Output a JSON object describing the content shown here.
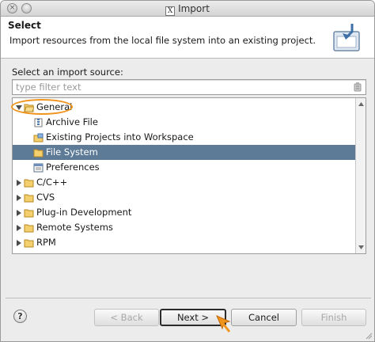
{
  "window": {
    "title": "Import",
    "title_logo": "X"
  },
  "header": {
    "title": "Select",
    "description": "Import resources from the local file system into an existing project.",
    "icon": "import-wizard-icon"
  },
  "source": {
    "label": "Select an import source:",
    "filter_placeholder": "type filter text",
    "filter_value": ""
  },
  "tree": {
    "items": [
      {
        "label": "General",
        "expanded": true,
        "level": 0,
        "icon": "folder-open-icon"
      },
      {
        "label": "Archive File",
        "level": 1,
        "icon": "archive-file-icon"
      },
      {
        "label": "Existing Projects into Workspace",
        "level": 1,
        "icon": "existing-projects-icon"
      },
      {
        "label": "File System",
        "level": 1,
        "icon": "folder-icon",
        "selected": true
      },
      {
        "label": "Preferences",
        "level": 1,
        "icon": "preferences-icon"
      },
      {
        "label": "C/C++",
        "expanded": false,
        "level": 0,
        "icon": "folder-icon"
      },
      {
        "label": "CVS",
        "expanded": false,
        "level": 0,
        "icon": "folder-icon"
      },
      {
        "label": "Plug-in Development",
        "expanded": false,
        "level": 0,
        "icon": "folder-icon"
      },
      {
        "label": "Remote Systems",
        "expanded": false,
        "level": 0,
        "icon": "folder-icon"
      },
      {
        "label": "RPM",
        "expanded": false,
        "level": 0,
        "icon": "folder-icon"
      }
    ]
  },
  "buttons": {
    "help": "?",
    "back": "< Back",
    "next": "Next >",
    "cancel": "Cancel",
    "finish": "Finish"
  },
  "colors": {
    "selection": "#5d7a96",
    "highlight": "#f0941e",
    "folder": "#e9b84a"
  }
}
